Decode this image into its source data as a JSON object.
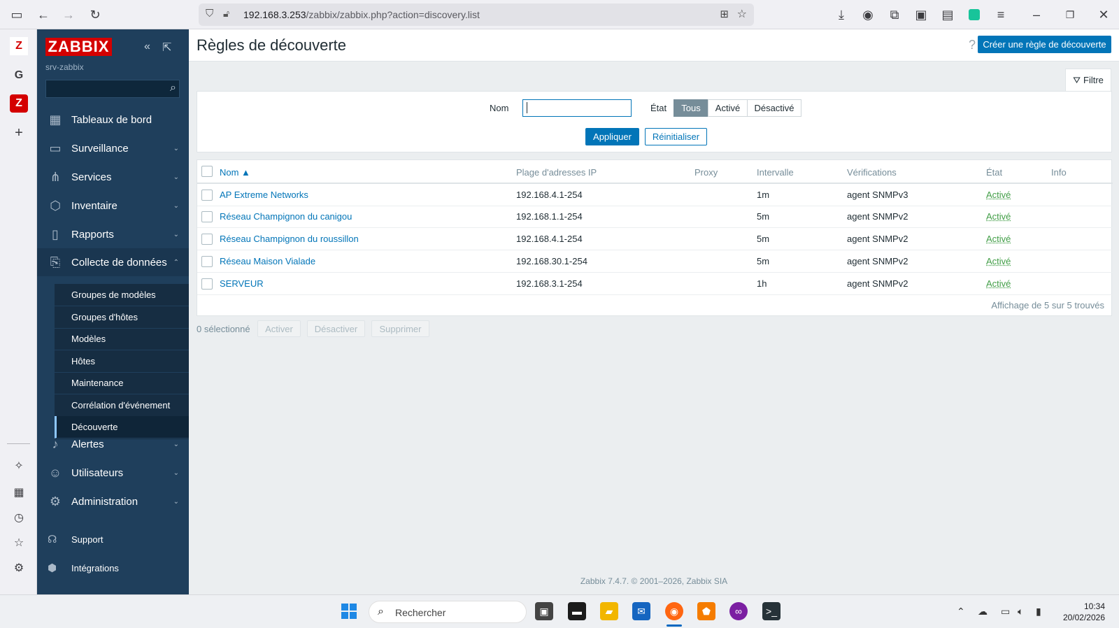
{
  "browser": {
    "url_host": "192.168.3.253",
    "url_path": "/zabbix/zabbix.php?action=discovery.list"
  },
  "sidebar": {
    "logo": "ZABBIX",
    "server": "srv-zabbix",
    "menu": [
      {
        "label": "Tableaux de bord",
        "icon": "dashboard-icon"
      },
      {
        "label": "Surveillance",
        "icon": "monitoring-icon"
      },
      {
        "label": "Services",
        "icon": "services-icon"
      },
      {
        "label": "Inventaire",
        "icon": "inventory-icon"
      },
      {
        "label": "Rapports",
        "icon": "reports-icon"
      },
      {
        "label": "Collecte de données",
        "icon": "data-collection-icon"
      }
    ],
    "submenu": [
      "Groupes de modèles",
      "Groupes d'hôtes",
      "Modèles",
      "Hôtes",
      "Maintenance",
      "Corrélation d'événement",
      "Découverte"
    ],
    "menu_after": [
      {
        "label": "Alertes",
        "icon": "bell-icon"
      },
      {
        "label": "Utilisateurs",
        "icon": "users-icon"
      },
      {
        "label": "Administration",
        "icon": "gear-icon"
      }
    ],
    "footer": [
      {
        "label": "Support",
        "icon": "headset-icon"
      },
      {
        "label": "Intégrations",
        "icon": "integrations-icon"
      }
    ]
  },
  "header": {
    "title": "Règles de découverte",
    "create_button": "Créer une règle de découverte"
  },
  "filter": {
    "tab_label": "Filtre",
    "name_label": "Nom",
    "name_value": "",
    "state_label": "État",
    "state_options": [
      "Tous",
      "Activé",
      "Désactivé"
    ],
    "state_selected": "Tous",
    "apply": "Appliquer",
    "reset": "Réinitialiser"
  },
  "table": {
    "columns": [
      "Nom ▲",
      "Plage d'adresses IP",
      "Proxy",
      "Intervalle",
      "Vérifications",
      "État",
      "Info"
    ],
    "rows": [
      {
        "name": "AP Extreme Networks",
        "ip": "192.168.4.1-254",
        "proxy": "",
        "interval": "1m",
        "checks": "agent SNMPv3",
        "state": "Activé"
      },
      {
        "name": "Réseau Champignon du canigou",
        "ip": "192.168.1.1-254",
        "proxy": "",
        "interval": "5m",
        "checks": "agent SNMPv2",
        "state": "Activé"
      },
      {
        "name": "Réseau Champignon du roussillon",
        "ip": "192.168.4.1-254",
        "proxy": "",
        "interval": "5m",
        "checks": "agent SNMPv2",
        "state": "Activé"
      },
      {
        "name": "Réseau Maison Vialade",
        "ip": "192.168.30.1-254",
        "proxy": "",
        "interval": "5m",
        "checks": "agent SNMPv2",
        "state": "Activé"
      },
      {
        "name": "SERVEUR",
        "ip": "192.168.3.1-254",
        "proxy": "",
        "interval": "1h",
        "checks": "agent SNMPv2",
        "state": "Activé"
      }
    ],
    "footer": "Affichage de 5 sur 5 trouvés"
  },
  "actions": {
    "selected": "0 sélectionné",
    "enable": "Activer",
    "disable": "Désactiver",
    "delete": "Supprimer"
  },
  "copyright": "Zabbix 7.4.7. © 2001–2026, Zabbix SIA",
  "taskbar": {
    "search_placeholder": "Rechercher",
    "time": "10:34",
    "date": "20/02/2026"
  },
  "colors": {
    "sidebar": "#1f3f5c",
    "primary": "#0275b8",
    "status_enabled": "#429e47",
    "logo_red": "#d40000"
  }
}
